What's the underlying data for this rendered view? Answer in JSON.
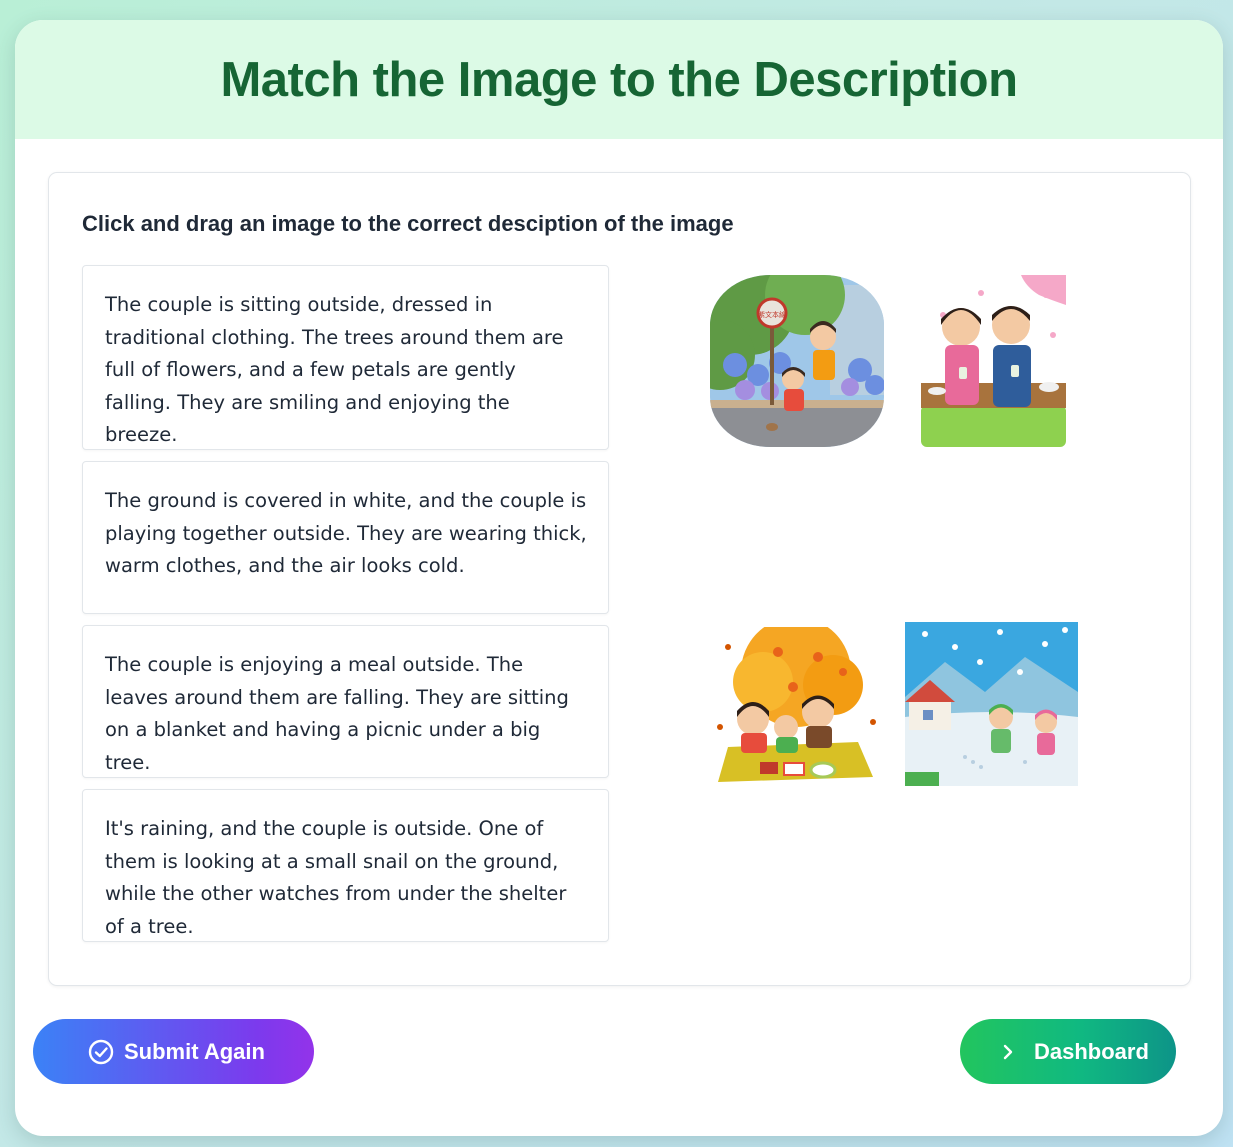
{
  "header": {
    "title": "Match the Image to the Description"
  },
  "activity": {
    "instruction": "Click and drag an image to the correct desciption of the image",
    "descriptions": [
      {
        "text": "The couple is sitting outside, dressed in traditional clothing. The trees around them are full of flowers, and a few petals are gently falling. They are smiling and enjoying the breeze."
      },
      {
        "text": "The ground is covered in white, and the couple is playing together outside. They are wearing thick, warm clothes, and the air looks cold."
      },
      {
        "text": "The couple is enjoying a meal outside. The leaves around them are falling. They are sitting on a blanket and having a picnic under a big tree."
      },
      {
        "text": "It's raining, and the couple is outside. One of them is looking at a small snail on the ground, while the other watches from under the shelter of a tree."
      }
    ],
    "images": [
      {
        "name": "rainy-hydrangea-snail-image",
        "sign_text": "紫文本線"
      },
      {
        "name": "spring-blossom-kimono-couple-image"
      },
      {
        "name": "autumn-picnic-image"
      },
      {
        "name": "winter-snow-play-image"
      }
    ]
  },
  "buttons": {
    "submit_label": "Submit Again",
    "submit_icon": "check-circle-icon",
    "dashboard_label": "Dashboard",
    "dashboard_icon": "chevron-right-icon"
  },
  "colors": {
    "header_bg": "#dcfae6",
    "title": "#166534",
    "submit_gradient": [
      "#3b82f6",
      "#9333ea"
    ],
    "dashboard_gradient": [
      "#22c55e",
      "#0d9488"
    ]
  }
}
